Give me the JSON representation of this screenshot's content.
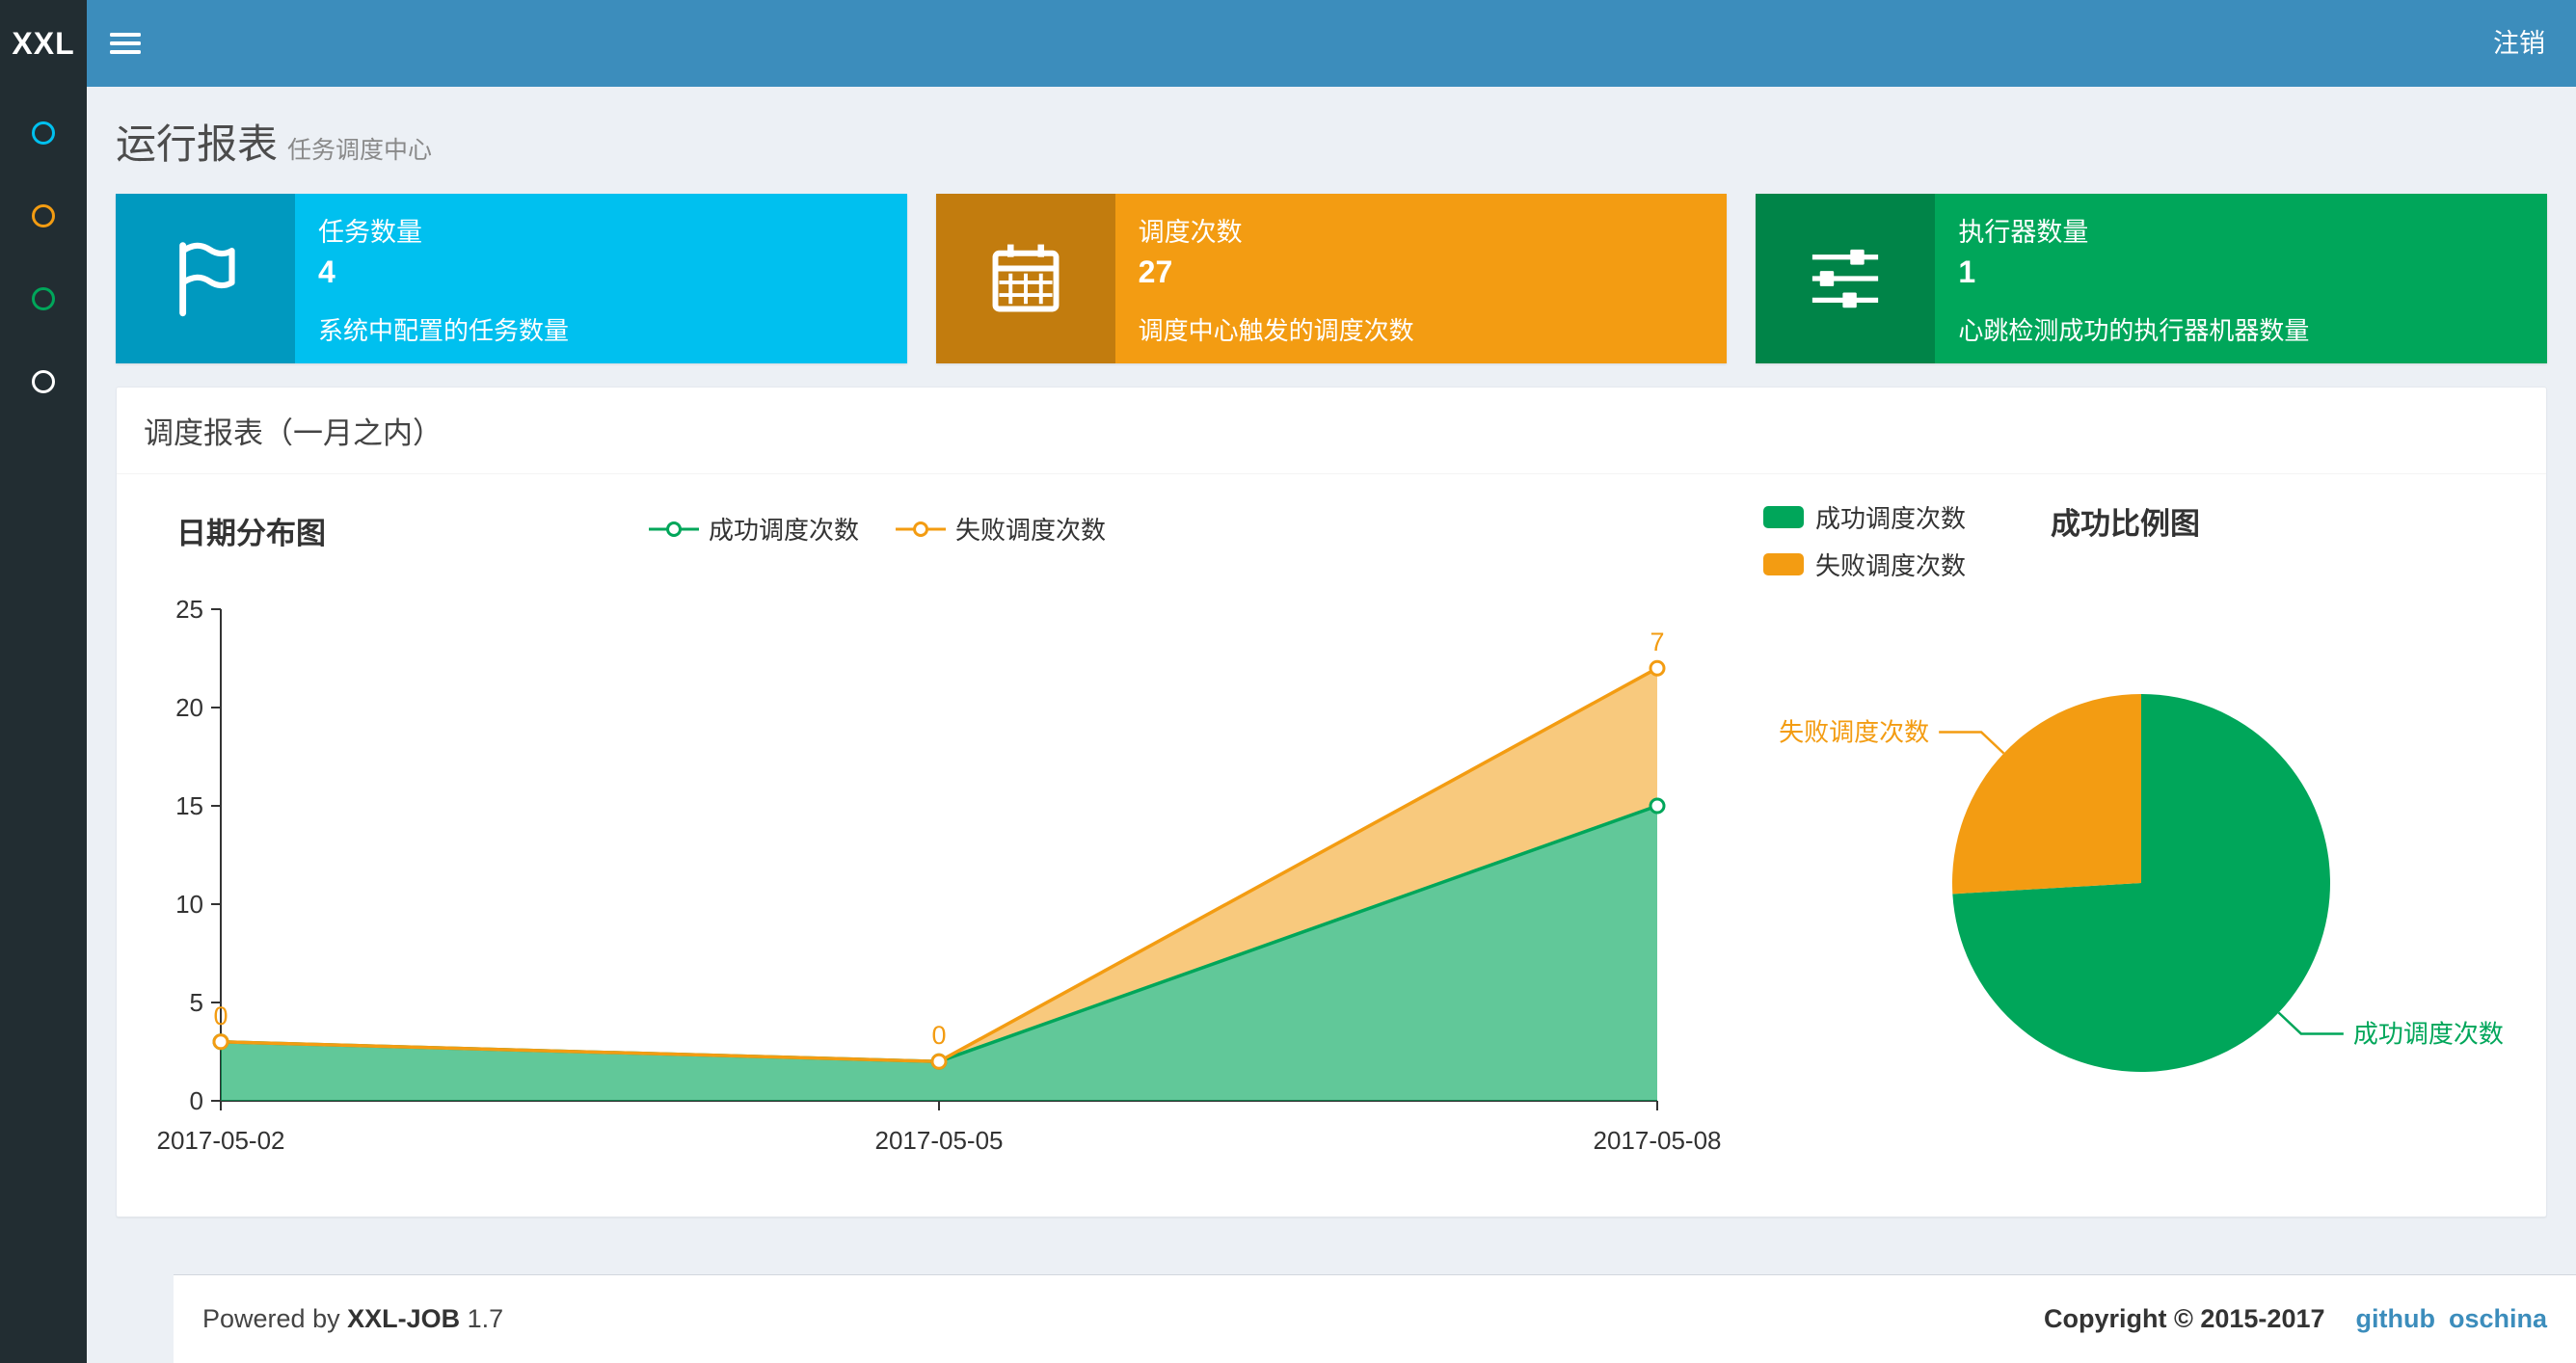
{
  "header": {
    "logo_text": "XXL",
    "logout_label": "注销"
  },
  "sidebar": {
    "items": [
      {
        "icon": "sidebar-item-1-icon",
        "color": "#00c0ef"
      },
      {
        "icon": "sidebar-item-2-icon",
        "color": "#f39c12"
      },
      {
        "icon": "sidebar-item-3-icon",
        "color": "#00a65a"
      },
      {
        "icon": "sidebar-item-4-icon",
        "color": "#ffffff"
      }
    ]
  },
  "page": {
    "title": "运行报表",
    "subtitle": "任务调度中心"
  },
  "stats": {
    "boxes": [
      {
        "title": "任务数量",
        "value": "4",
        "description": "系统中配置的任务数量",
        "color": "#00c0ef",
        "icon": "flag-icon"
      },
      {
        "title": "调度次数",
        "value": "27",
        "description": "调度中心触发的调度次数",
        "color": "#f39c12",
        "icon": "calendar-icon"
      },
      {
        "title": "执行器数量",
        "value": "1",
        "description": "心跳检测成功的执行器机器数量",
        "color": "#00a65a",
        "icon": "sliders-icon"
      }
    ]
  },
  "report": {
    "panel_title": "调度报表（一月之内）"
  },
  "chart_data": [
    {
      "type": "area",
      "title": "日期分布图",
      "x": [
        "2017-05-02",
        "2017-05-05",
        "2017-05-08"
      ],
      "series": [
        {
          "name": "成功调度次数",
          "color": "#00A65A",
          "values": [
            3,
            2,
            15
          ]
        },
        {
          "name": "失败调度次数",
          "color": "#F39C12",
          "values": [
            0,
            0,
            7
          ]
        }
      ],
      "stacked": true,
      "point_labels_series": "失败调度次数",
      "point_labels": [
        "0",
        "0",
        "7"
      ],
      "ylim": [
        0,
        25
      ],
      "yticks": [
        0,
        5,
        10,
        15,
        20,
        25
      ],
      "legend_position": "top",
      "grid": false
    },
    {
      "type": "pie",
      "title": "成功比例图",
      "slices": [
        {
          "name": "成功调度次数",
          "value": 20,
          "color": "#00A65A"
        },
        {
          "name": "失败调度次数",
          "value": 7,
          "color": "#F39C12"
        }
      ],
      "legend_position": "top-left"
    }
  ],
  "footer": {
    "powered_prefix": "Powered by",
    "product": "XXL-JOB",
    "version": "1.7",
    "copyright": "Copyright © 2015-2017",
    "links": [
      {
        "label": "github"
      },
      {
        "label": "oschina"
      }
    ]
  },
  "colors": {
    "navbar": "#3c8dbc",
    "sidebar": "#222d32",
    "aqua": "#00c0ef",
    "yellow": "#f39c12",
    "green": "#00a65a",
    "link": "#3c8dbc"
  }
}
